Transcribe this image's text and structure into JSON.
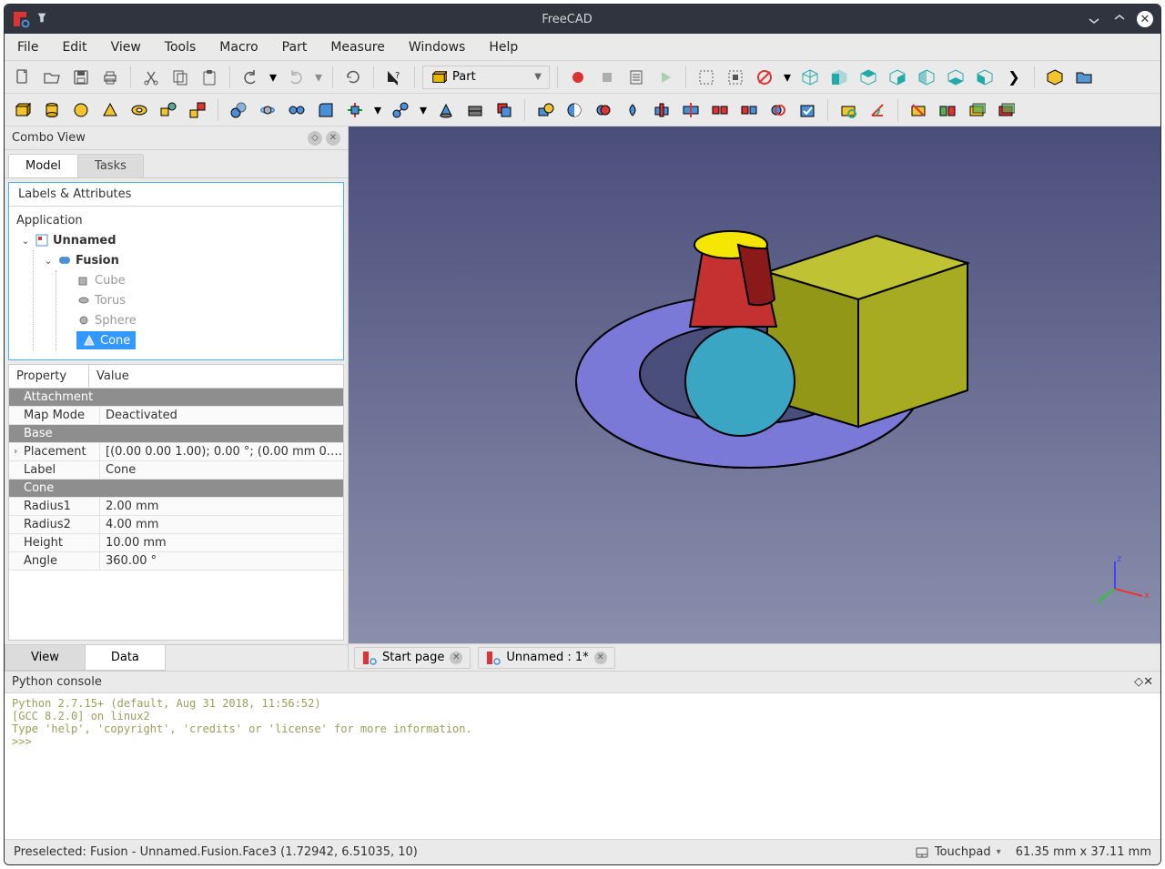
{
  "window": {
    "title": "FreeCAD"
  },
  "menubar": [
    "File",
    "Edit",
    "View",
    "Tools",
    "Macro",
    "Part",
    "Measure",
    "Windows",
    "Help"
  ],
  "workbench": {
    "selected": "Part"
  },
  "combo": {
    "title": "Combo View",
    "tabs": {
      "model": "Model",
      "tasks": "Tasks"
    },
    "tree_header": "Labels & Attributes",
    "root": "Application",
    "doc": "Unnamed",
    "fusion": "Fusion",
    "children": [
      "Cube",
      "Torus",
      "Sphere",
      "Cone"
    ],
    "selected_index": 3
  },
  "properties": {
    "headers": {
      "prop": "Property",
      "val": "Value"
    },
    "groups": [
      {
        "name": "Attachment",
        "rows": [
          {
            "k": "Map Mode",
            "v": "Deactivated"
          }
        ]
      },
      {
        "name": "Base",
        "rows": [
          {
            "k": "Placement",
            "v": "[(0.00 0.00 1.00); 0.00 °; (0.00 mm  0.00 mm...",
            "expandable": true
          },
          {
            "k": "Label",
            "v": "Cone"
          }
        ]
      },
      {
        "name": "Cone",
        "rows": [
          {
            "k": "Radius1",
            "v": "2.00 mm"
          },
          {
            "k": "Radius2",
            "v": "4.00 mm"
          },
          {
            "k": "Height",
            "v": "10.00 mm"
          },
          {
            "k": "Angle",
            "v": "360.00 °"
          }
        ]
      }
    ],
    "bottom_tabs": {
      "view": "View",
      "data": "Data"
    }
  },
  "doc_tabs": [
    {
      "label": "Start page"
    },
    {
      "label": "Unnamed : 1*"
    }
  ],
  "console": {
    "title": "Python console",
    "text": "Python 2.7.15+ (default, Aug 31 2018, 11:56:52)\n[GCC 8.2.0] on linux2\nType 'help', 'copyright', 'credits' or 'license' for more information.\n>>> "
  },
  "status": {
    "left": "Preselected: Fusion - Unnamed.Fusion.Face3 (1.72942, 6.51035, 10)",
    "navmode": "Touchpad",
    "dims": "61.35 mm x 37.11 mm"
  },
  "axes": {
    "x": "x",
    "y": "y",
    "z": "z"
  }
}
